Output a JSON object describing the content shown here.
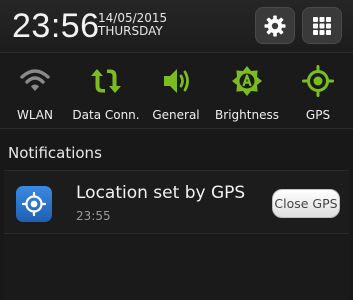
{
  "status": {
    "time": "23:56",
    "date": "14/05/2015",
    "weekday": "THURSDAY"
  },
  "header_buttons": [
    {
      "name": "settings",
      "icon": "gear-icon"
    },
    {
      "name": "all-apps",
      "icon": "grid-icon"
    }
  ],
  "quick_settings": [
    {
      "label": "WLAN",
      "icon": "wifi-icon",
      "active": false
    },
    {
      "label": "Data Conn.",
      "icon": "data-transfer-icon",
      "active": true
    },
    {
      "label": "General",
      "icon": "speaker-icon",
      "active": true
    },
    {
      "label": "Brightness",
      "icon": "brightness-auto-icon",
      "active": true
    },
    {
      "label": "GPS",
      "icon": "gps-icon",
      "active": true
    }
  ],
  "colors": {
    "active": "#7bbd1e",
    "inactive": "#8a8a8a",
    "accent_blue": "#2e78d2"
  },
  "notifications": {
    "title": "Notifications",
    "items": [
      {
        "icon": "location-icon",
        "text": "Location set by GPS",
        "time": "23:55",
        "action": "Close GPS"
      }
    ]
  }
}
